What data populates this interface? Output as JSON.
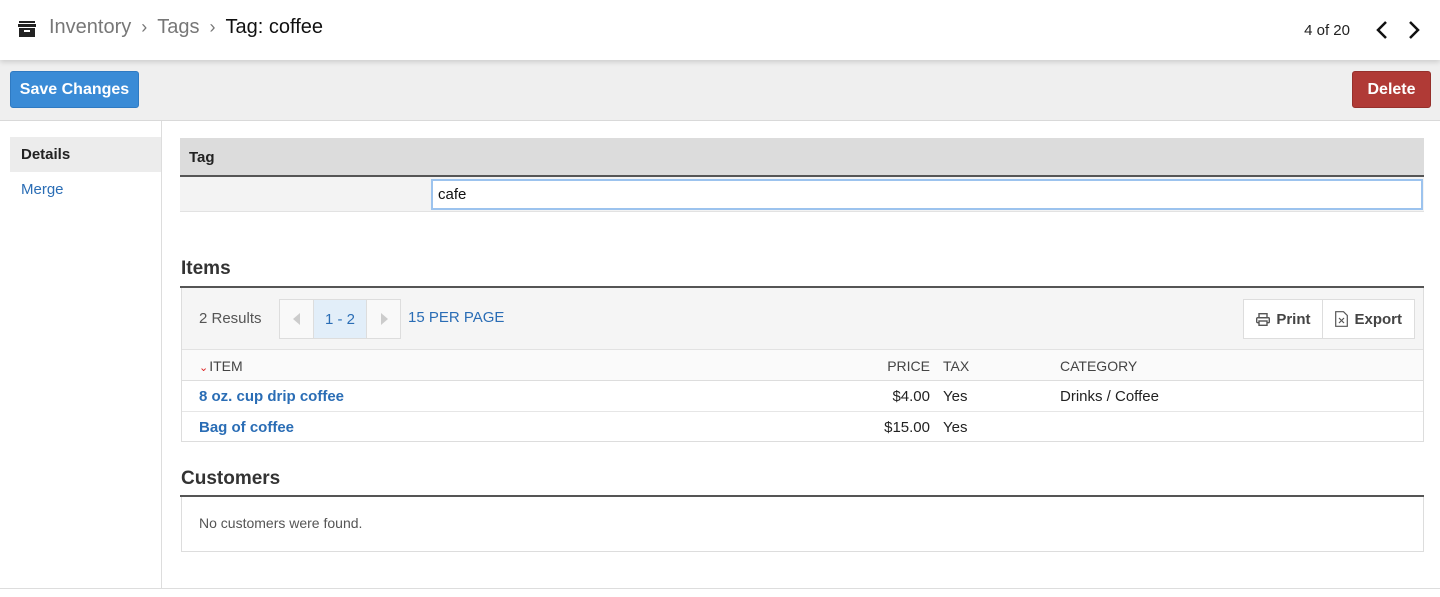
{
  "header": {
    "breadcrumb": [
      "Inventory",
      "Tags",
      "Tag: coffee"
    ],
    "record_position": "4 of 20"
  },
  "actions": {
    "save_label": "Save Changes",
    "delete_label": "Delete"
  },
  "sidebar": {
    "items": [
      {
        "label": "Details",
        "active": true
      },
      {
        "label": "Merge",
        "active": false
      }
    ]
  },
  "tag_form": {
    "header": "Tag",
    "name_value": "cafe"
  },
  "items_section": {
    "title": "Items",
    "results": "2 Results",
    "page_range": "1 - 2",
    "per_page": "15 PER PAGE",
    "print_label": "Print",
    "export_label": "Export",
    "columns": [
      "ITEM",
      "PRICE",
      "TAX",
      "CATEGORY"
    ],
    "rows": [
      {
        "item": "8 oz. cup drip coffee",
        "price": "$4.00",
        "tax": "Yes",
        "category": "Drinks / Coffee"
      },
      {
        "item": "Bag of coffee",
        "price": "$15.00",
        "tax": "Yes",
        "category": ""
      }
    ]
  },
  "customers_section": {
    "title": "Customers",
    "empty_message": "No customers were found."
  },
  "colors": {
    "primary": "#3a8bd6",
    "danger": "#b03a36",
    "link": "#2a6db5"
  }
}
